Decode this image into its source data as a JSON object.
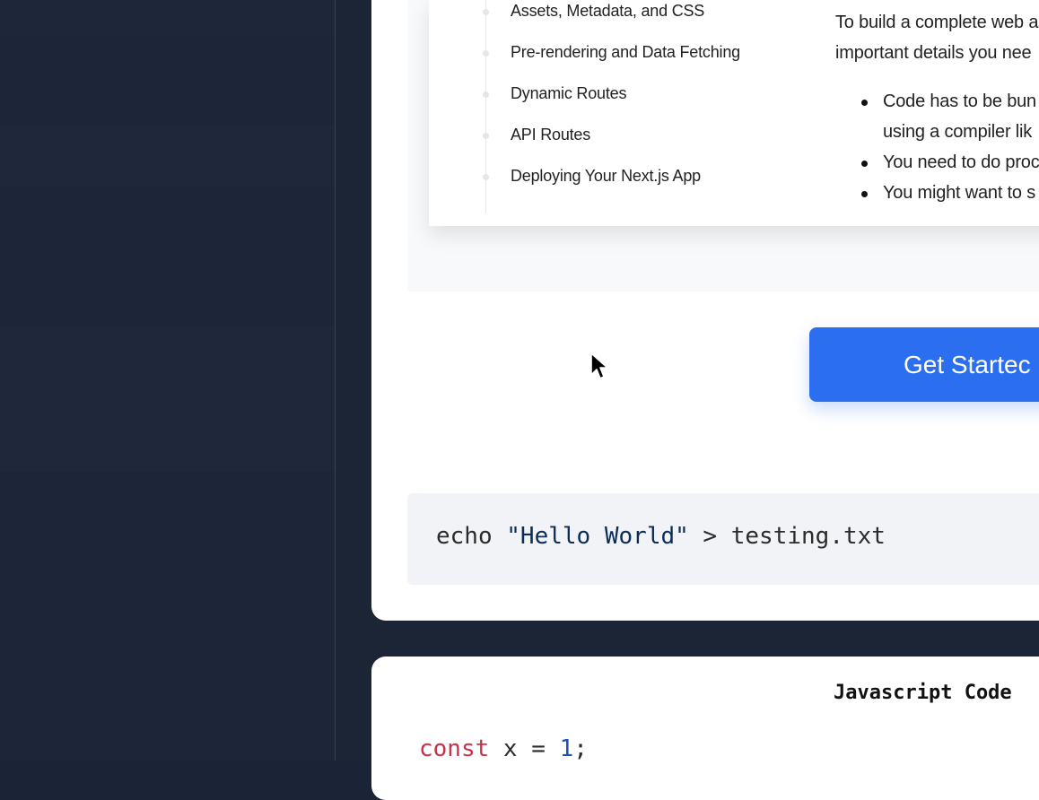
{
  "colors": {
    "sidebar_bg": "#1d2638",
    "page_bg": "#1b2436",
    "card_bg": "#ffffff",
    "accent": "#2b6ef0",
    "code_bg": "#f1f3f7",
    "keyword": "#c8324a",
    "string": "#0c2d57",
    "number": "#1d4fb8"
  },
  "preview": {
    "toc": [
      "Assets, Metadata, and CSS",
      "Pre-rendering and Data Fetching",
      "Dynamic Routes",
      "API Routes",
      "Deploying Your Next.js App"
    ],
    "para_line1": "To build a complete web a",
    "para_line2": "important details you nee",
    "bullets": [
      "Code has to be bun",
      "using a compiler lik",
      "You need to do proc",
      "You might want to s"
    ]
  },
  "cta": {
    "label": "Get Startec"
  },
  "shell_code": {
    "cmd": "echo ",
    "string": "\"Hello World\"",
    "rest": " > testing.txt"
  },
  "js_card": {
    "title": "Javascript Code",
    "kw": "const",
    "mid": " x = ",
    "num": "1",
    "end": ";"
  },
  "icons": [
    "mouse-pointer-icon"
  ]
}
